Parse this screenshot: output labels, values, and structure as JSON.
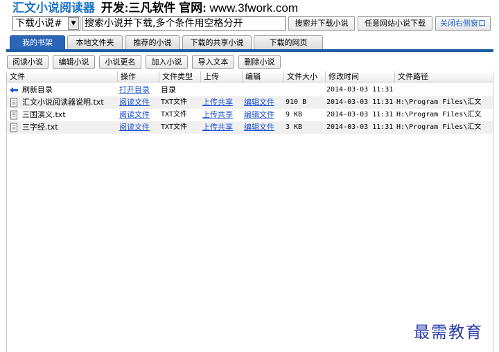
{
  "header": {
    "app_name": "汇文小说阅读器",
    "dev_text": "开发:三凡软件 官网:",
    "site": "www.3fwork.com"
  },
  "search": {
    "mode_selected": "下载小说#",
    "query": "搜索小说并下载,多个条件用空格分开",
    "search_download_label": "搜索并下载小说",
    "any_site_download_label": "任意网站小说下载",
    "close_panel_label": "关闭右侧窗口"
  },
  "tabs": [
    {
      "label": "我的书架",
      "active": true
    },
    {
      "label": "本地文件夹",
      "active": false
    },
    {
      "label": "推荐的小说",
      "active": false
    },
    {
      "label": "下载的共享小说",
      "active": false
    },
    {
      "label": "下载的网页",
      "active": false
    }
  ],
  "toolbar": {
    "read": "阅读小说",
    "edit": "编辑小说",
    "rename": "小说更名",
    "add": "加入小说",
    "import": "导入文本",
    "delete": "删除小说"
  },
  "table": {
    "columns": [
      "文件",
      "操作",
      "文件类型",
      "上传",
      "编辑",
      "文件大小",
      "修改时间",
      "文件路径"
    ],
    "rows": [
      {
        "icon": "back-arrow-icon",
        "name": "刷新目录",
        "action": "打开目录",
        "type": "目录",
        "upload": "",
        "edit": "",
        "size": "",
        "mtime": "2014-03-03 11:31",
        "path": ""
      },
      {
        "icon": "document-icon",
        "name": "汇文小说阅读器说明.txt",
        "action": "阅读文件",
        "type": "TXT文件",
        "upload": "上传共享",
        "edit": "编辑文件",
        "size": "910 B",
        "mtime": "2014-03-03 11:31",
        "path": "H:\\Program Files\\汇文"
      },
      {
        "icon": "document-icon",
        "name": "三国演义.txt",
        "action": "阅读文件",
        "type": "TXT文件",
        "upload": "上传共享",
        "edit": "编辑文件",
        "size": "9 KB",
        "mtime": "2014-03-03 11:31",
        "path": "H:\\Program Files\\汇文"
      },
      {
        "icon": "document-icon",
        "name": "三字经.txt",
        "action": "阅读文件",
        "type": "TXT文件",
        "upload": "上传共享",
        "edit": "编辑文件",
        "size": "3 KB",
        "mtime": "2014-03-03 11:31",
        "path": "H:\\Program Files\\汇文"
      }
    ]
  },
  "watermark": "最需教育",
  "colors": {
    "brand_blue": "#1a73c4",
    "tab_active": "#2a65b8",
    "link": "#1a4fd0"
  }
}
